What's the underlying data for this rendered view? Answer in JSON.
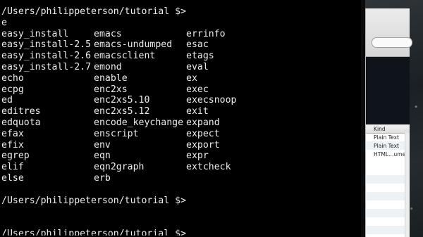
{
  "terminal": {
    "prompt1": "/Users/philippeterson/tutorial $>",
    "typed": "e",
    "completions": [
      [
        "easy_install",
        "emacs",
        "errinfo"
      ],
      [
        "easy_install-2.5",
        "emacs-undumped",
        "esac"
      ],
      [
        "easy_install-2.6",
        "emacsclient",
        "etags"
      ],
      [
        "easy_install-2.7",
        "emond",
        "eval"
      ],
      [
        "echo",
        "enable",
        "ex"
      ],
      [
        "ecpg",
        "enc2xs",
        "exec"
      ],
      [
        "ed",
        "enc2xs5.10",
        "execsnoop"
      ],
      [
        "editres",
        "enc2xs5.12",
        "exit"
      ],
      [
        "edquota",
        "encode_keychange",
        "expand"
      ],
      [
        "efax",
        "enscript",
        "expect"
      ],
      [
        "efix",
        "env",
        "export"
      ],
      [
        "egrep",
        "eqn",
        "expr"
      ],
      [
        "elif",
        "eqn2graph",
        "extcheck"
      ],
      [
        "else",
        "erb",
        ""
      ]
    ],
    "prompt2": "/Users/philippeterson/tutorial $>",
    "prompt3": "/Users/philippeterson/tutorial $>"
  },
  "finder": {
    "column_header": "Kind",
    "rows": [
      "Plain Text",
      "Plain Text",
      "HTML...ument"
    ]
  },
  "colors": {
    "terminal_bg": "#000000",
    "terminal_fg": "#ededed"
  }
}
